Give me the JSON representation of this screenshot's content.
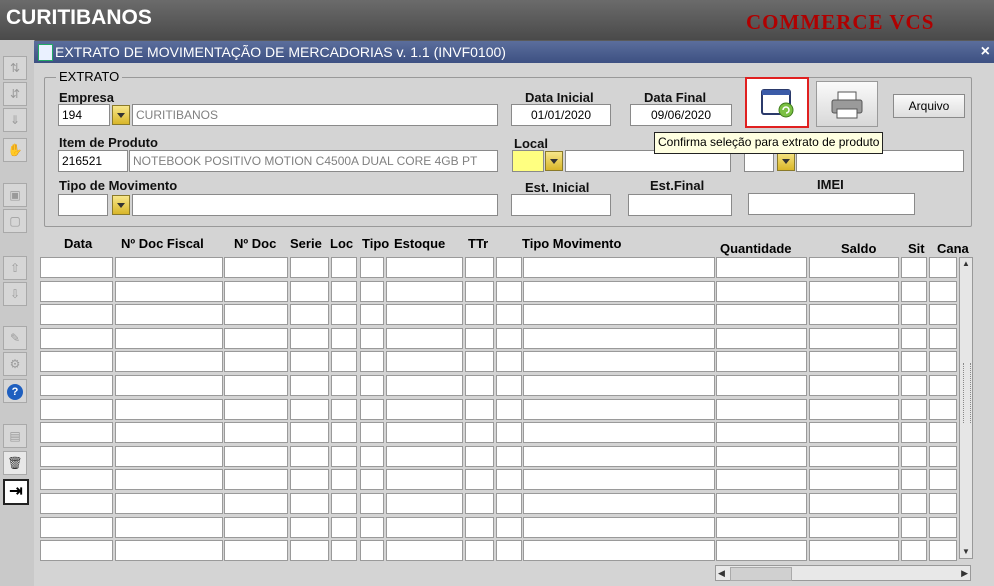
{
  "app": {
    "header_title": "CURITIBANOS",
    "brand": "COMMERCE VCS"
  },
  "window": {
    "title": "EXTRATO DE MOVIMENTAÇÃO DE MERCADORIAS v. 1.1 (INVF0100)",
    "close": "×"
  },
  "form": {
    "group_title": "EXTRATO",
    "empresa": {
      "label": "Empresa",
      "code": "194",
      "name": "CURITIBANOS"
    },
    "data_inicial": {
      "label": "Data Inicial",
      "value": "01/01/2020"
    },
    "data_final": {
      "label": "Data Final",
      "value": "09/06/2020"
    },
    "item": {
      "label": "Item de Produto",
      "code": "216521",
      "desc": "NOTEBOOK POSITIVO MOTION C4500A DUAL CORE 4GB PT"
    },
    "local": {
      "label": "Local"
    },
    "tipo_mov": {
      "label": "Tipo de Movimento"
    },
    "est_inicial": {
      "label": "Est. Inicial"
    },
    "est_final": {
      "label": "Est.Final"
    },
    "imei": {
      "label": "IMEI"
    },
    "arquivo_button": "Arquivo",
    "tooltip": "Confirma seleção para extrato de produto"
  },
  "table": {
    "columns": [
      "Data",
      "Nº Doc Fiscal",
      "Nº Doc",
      "Serie",
      "Loc",
      "Tipo",
      "Estoque",
      "TTr",
      "Tipo Movimento",
      "Quantidade",
      "Saldo",
      "Sit",
      "Cana"
    ]
  },
  "icons": {
    "confirm": "window-refresh-icon",
    "print": "printer-icon",
    "help": "help-icon",
    "exit": "exit-arrow-icon"
  },
  "colors": {
    "brand": "#b00000",
    "titlebar": "#4a5d8f",
    "selected_border": "#e02020"
  }
}
